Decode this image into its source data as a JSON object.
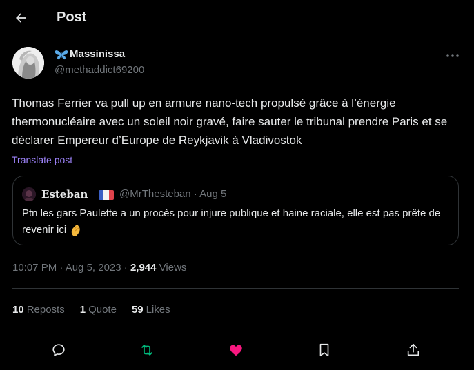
{
  "header": {
    "title": "Post"
  },
  "author": {
    "name": "Massinissa",
    "handle": "@methaddict69200"
  },
  "post": {
    "text": "Thomas Ferrier va pull up en armure nano-tech propulsé grâce à l’énergie thermonucléaire avec un soleil noir gravé, faire sauter le tribunal prendre Paris et se déclarer Empereur d’Europe de Reykjavik à Vladivostok",
    "translate_label": "Translate post"
  },
  "quote": {
    "name": "Esteban",
    "handle_date": "@MrThesteban · Aug 5",
    "text": "Ptn les gars Paulette a un procès pour injure publique et haine raciale, elle est pas prête de revenir ici"
  },
  "meta": {
    "time_date": "10:07 PM · Aug 5, 2023 · ",
    "views_count": "2,944",
    "views_label": " Views"
  },
  "stats": {
    "reposts_count": "10",
    "reposts_label": "Reposts",
    "quotes_count": "1",
    "quotes_label": "Quote",
    "likes_count": "59",
    "likes_label": "Likes"
  },
  "colors": {
    "background": "#000000",
    "text": "#e7e9ea",
    "muted": "#71767b",
    "link": "#9c82f8",
    "repost_active": "#00ba7c",
    "like_active": "#f91880",
    "border": "#2f3336"
  },
  "icons": [
    "back-arrow-icon",
    "butterfly-icon",
    "more-icon",
    "france-flag-icon",
    "pinched-fingers-icon",
    "reply-icon",
    "repost-icon",
    "like-icon",
    "bookmark-icon",
    "share-icon"
  ]
}
